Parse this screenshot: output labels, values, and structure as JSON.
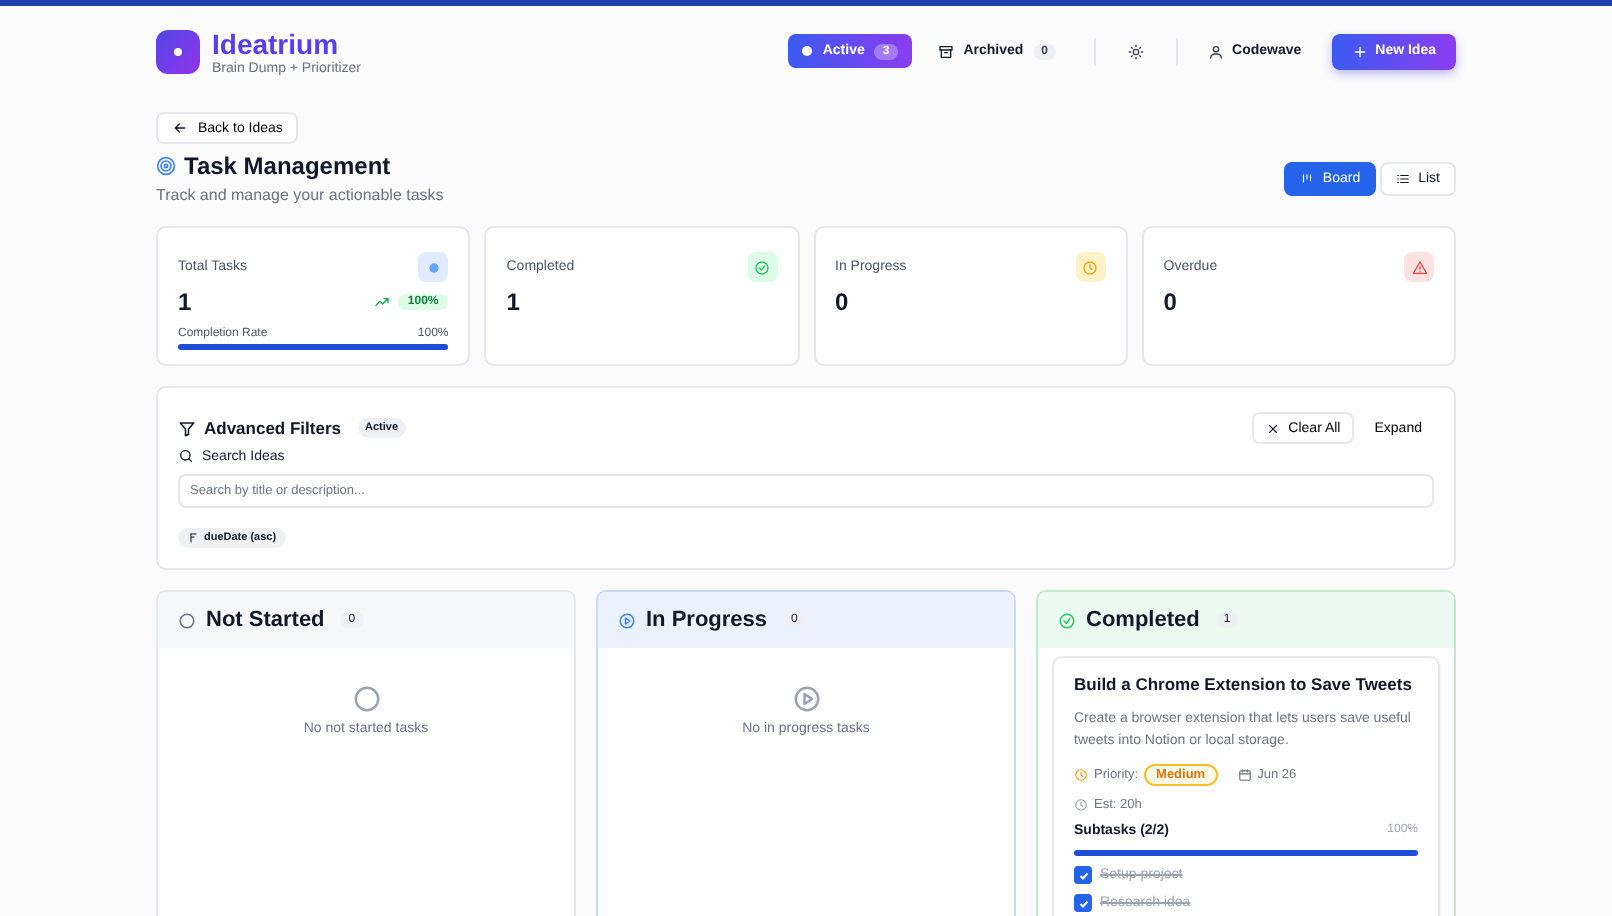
{
  "app": {
    "name": "Ideatrium",
    "tagline": "Brain Dump + Prioritizer"
  },
  "nav": {
    "tabs": [
      {
        "label": "Active",
        "count": "3",
        "selected": true
      },
      {
        "label": "Archived",
        "count": "0",
        "selected": false
      }
    ],
    "user": "Codewave",
    "new_button": "New Idea"
  },
  "back_button": "Back to Ideas",
  "title": "Task Management",
  "subtitle": "Track and manage your actionable tasks",
  "views": [
    {
      "label": "Board",
      "selected": true
    },
    {
      "label": "List",
      "selected": false
    }
  ],
  "stats": [
    {
      "kind": "total",
      "label": "Total Tasks",
      "value": "1",
      "trend": "100%",
      "rate_label": "Completion Rate",
      "rate": "100%",
      "level": 1
    },
    {
      "kind": "completed",
      "label": "Completed",
      "value": "1"
    },
    {
      "kind": "progress",
      "label": "In Progress",
      "value": "0"
    },
    {
      "kind": "overdue",
      "label": "Overdue",
      "value": "0"
    }
  ],
  "filters": {
    "title": "Advanced Filters",
    "badge": "Active",
    "clear_button": "Clear All",
    "expand_button": "Expand",
    "search_label": "Search Ideas",
    "search": {
      "placeholder": "Search by title or description..."
    },
    "sort_chip": "dueDate (asc)"
  },
  "columns": [
    {
      "kind": "not_started",
      "title": "Not Started",
      "count": "0",
      "empty_text": "No not started tasks"
    },
    {
      "kind": "in_progress",
      "title": "In Progress",
      "count": "0",
      "empty_text": "No in progress tasks"
    },
    {
      "kind": "completed",
      "title": "Completed",
      "count": "1",
      "tasks": [
        {
          "title": "Build a Chrome Extension to Save Tweets",
          "description": "Create a browser extension that lets users save useful tweets into Notion or local storage.",
          "priority_label": "Priority:",
          "priority": "Medium",
          "date": "Jun 26",
          "estimate": "Est: 20h",
          "subtasks_label": "Subtasks (2/2)",
          "subtasks_percent": "100%",
          "level": 1,
          "subtasks": [
            {
              "label": "Setup project",
              "checked": true
            },
            {
              "label": "Research idea",
              "checked": true
            }
          ]
        }
      ]
    }
  ]
}
